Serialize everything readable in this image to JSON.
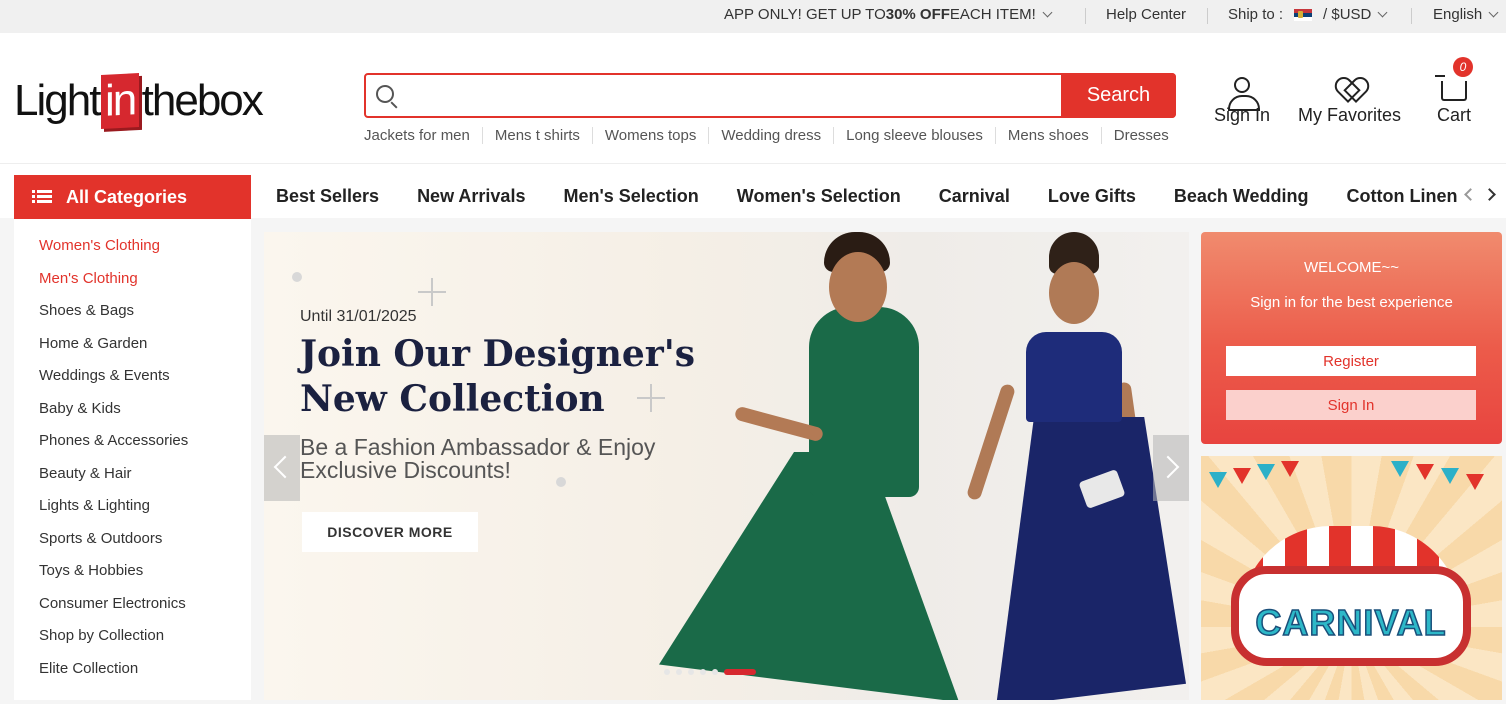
{
  "topbar": {
    "promo_prefix": "APP ONLY! GET UP TO ",
    "promo_bold": "30% OFF",
    "promo_suffix": " EACH ITEM!",
    "help": "Help Center",
    "ship_label": "Ship to :",
    "currency": "/  $USD",
    "language": "English"
  },
  "header": {
    "logo_left": "Light",
    "logo_mid": "in",
    "logo_right": "thebox",
    "search_placeholder": "",
    "search_button": "Search",
    "hot_searches": [
      "Jackets for men",
      "Mens t shirts",
      "Womens tops",
      "Wedding dress",
      "Long sleeve blouses",
      "Mens shoes",
      "Dresses"
    ],
    "sign_in": "Sign In",
    "favorites": "My Favorites",
    "cart": "Cart",
    "cart_count": "0"
  },
  "nav": {
    "all_categories": "All Categories",
    "links": [
      "Best Sellers",
      "New Arrivals",
      "Men's Selection",
      "Women's Selection",
      "Carnival",
      "Love Gifts",
      "Beach Wedding",
      "Cotton Linen"
    ]
  },
  "sidebar": {
    "items": [
      "Women's Clothing",
      "Men's Clothing",
      "Shoes & Bags",
      "Home & Garden",
      "Weddings & Events",
      "Baby & Kids",
      "Phones & Accessories",
      "Beauty & Hair",
      "Lights & Lighting",
      "Sports & Outdoors",
      "Toys & Hobbies",
      "Consumer Electronics",
      "Shop by Collection",
      "Elite Collection"
    ]
  },
  "banner": {
    "date": "Until 31/01/2025",
    "title": "Join Our Designer's New Collection",
    "subtitle": "Be a Fashion Ambassador & Enjoy Exclusive Discounts!",
    "cta": "DISCOVER MORE",
    "slides": 6,
    "active_slide": 6
  },
  "welcome": {
    "title": "WELCOME~~",
    "subtitle": "Sign in for the best experience",
    "register": "Register",
    "sign_in": "Sign In"
  },
  "carnival": {
    "label": "CARNIVAL"
  },
  "colors": {
    "accent": "#e2332b",
    "banner_bg": "#f5efe6"
  }
}
